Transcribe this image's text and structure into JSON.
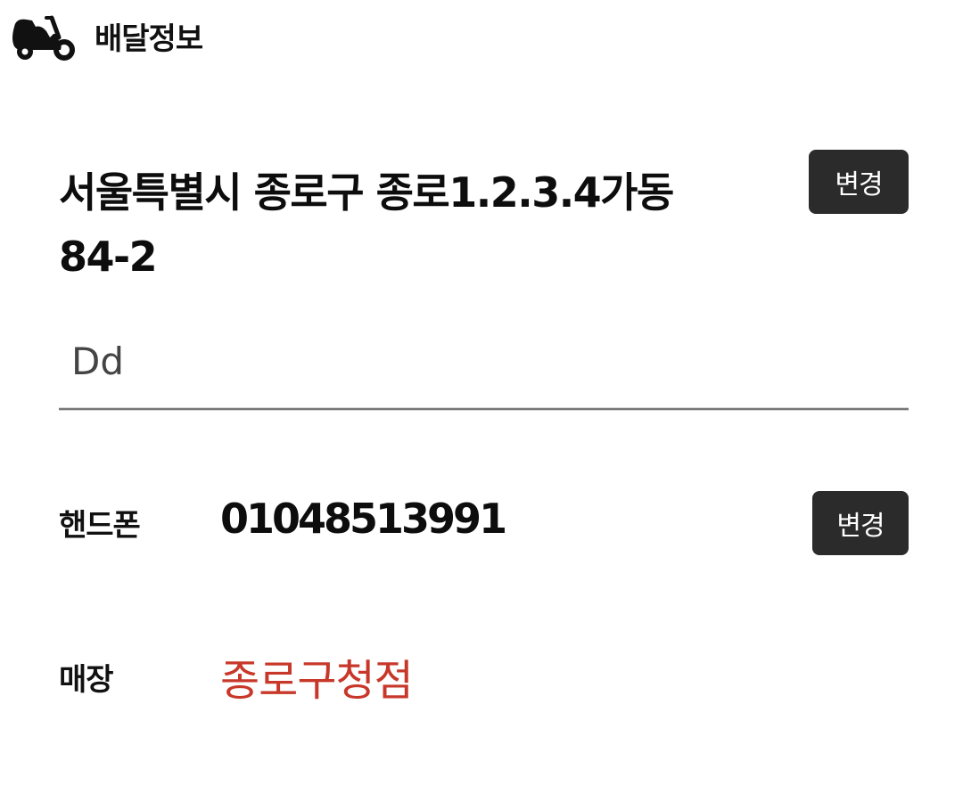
{
  "header": {
    "icon": "scooter-icon",
    "title": "배달정보"
  },
  "address": {
    "line1": "서울특별시 종로구 종로1.2.3.4가동",
    "line2": "84-2",
    "change_label": "변경"
  },
  "detail_address": {
    "value": "Dd"
  },
  "phone": {
    "label": "핸드폰",
    "value": "01048513991",
    "change_label": "변경"
  },
  "store": {
    "label": "매장",
    "value": "종로구청점"
  },
  "colors": {
    "button_bg": "#2b2b2b",
    "store_accent": "#c8382a",
    "text": "#111111"
  }
}
